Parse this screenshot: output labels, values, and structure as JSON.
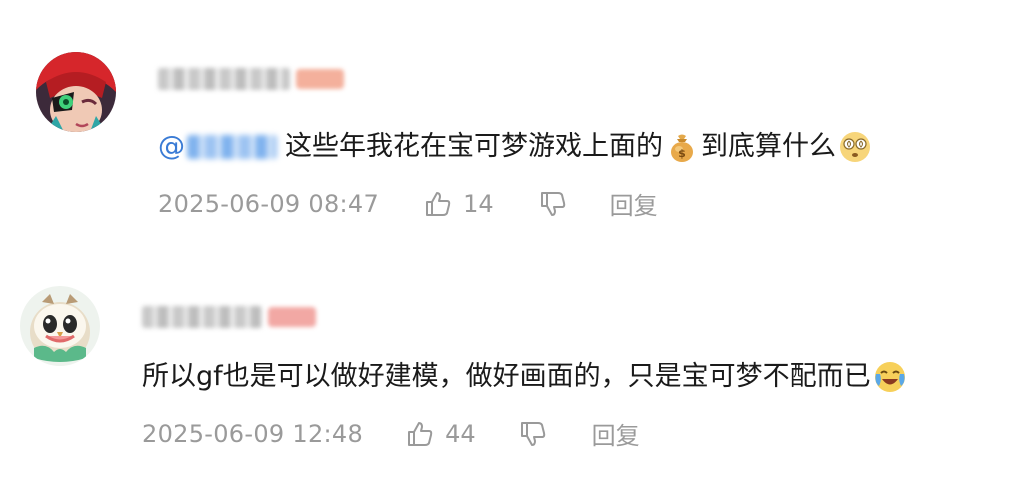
{
  "comments": [
    {
      "mention_prefix": "@",
      "text": "这些年我花在宝可梦游戏上面的",
      "text_tail": "到底算什么",
      "emojis": [
        "money-bag-icon",
        "dizzy-face-icon"
      ],
      "time": "2025-06-09 08:47",
      "likes": "14",
      "reply_label": "回复"
    },
    {
      "text": "所以gf也是可以做好建模，做好画面的，只是宝可梦不配而已",
      "emojis": [
        "laughing-crying-face-icon"
      ],
      "time": "2025-06-09 12:48",
      "likes": "44",
      "reply_label": "回复"
    }
  ],
  "colors": {
    "meta_gray": "#9a9a9a",
    "mention_blue": "#3a7bd5",
    "badge_pink": "#f2a8a4"
  }
}
